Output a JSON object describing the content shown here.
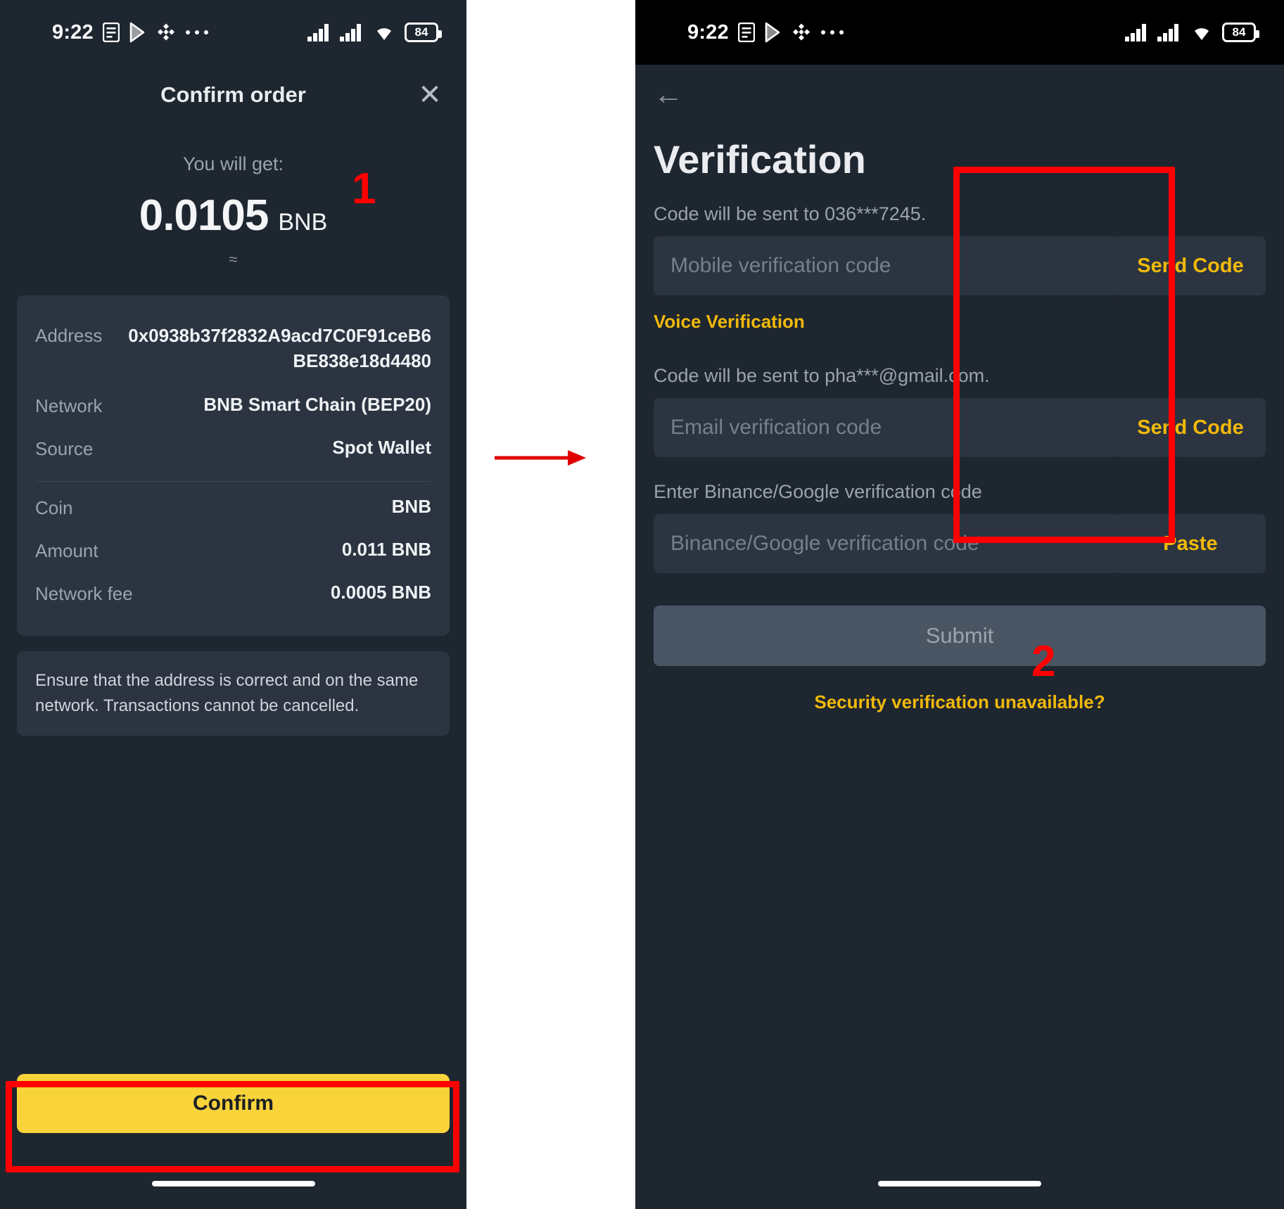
{
  "status_bar": {
    "time": "9:22",
    "battery_level": "84",
    "left_icons": [
      "note-icon",
      "play-store-icon",
      "binance-icon",
      "more-dots-icon"
    ],
    "right_icons": [
      "signal-bars-icon",
      "signal-bars-icon",
      "wifi-icon",
      "battery-icon"
    ]
  },
  "left_screen": {
    "title": "Confirm order",
    "close_label": "✕",
    "you_will_get_label": "You will get:",
    "amount_value": "0.0105",
    "amount_unit": "BNB",
    "approx_symbol": "≈",
    "details": [
      {
        "key": "Address",
        "value": "0x0938b37f2832A9acd7C0F91ceB6BE838e18d4480"
      },
      {
        "key": "Network",
        "value": "BNB Smart Chain (BEP20)"
      },
      {
        "key": "Source",
        "value": "Spot Wallet"
      }
    ],
    "summary": [
      {
        "key": "Coin",
        "value": "BNB"
      },
      {
        "key": "Amount",
        "value": "0.011 BNB"
      },
      {
        "key": "Network fee",
        "value": "0.0005 BNB"
      }
    ],
    "notice": "Ensure that the address is correct and on the same network. Transactions cannot be cancelled.",
    "confirm_button": "Confirm"
  },
  "right_screen": {
    "back_label": "←",
    "title": "Verification",
    "mobile_hint": "Code will be sent to 036***7245.",
    "mobile_placeholder": "Mobile verification code",
    "mobile_action": "Send Code",
    "voice_link": "Voice Verification",
    "email_hint": "Code will be sent to pha***@gmail.com.",
    "email_placeholder": "Email verification code",
    "email_action": "Send Code",
    "auth_hint": "Enter Binance/Google verification code",
    "auth_placeholder": "Binance/Google verification code",
    "auth_action": "Paste",
    "submit_button": "Submit",
    "unavailable_link": "Security verification unavailable?"
  },
  "annotations": {
    "step_one": "1",
    "step_two": "2",
    "highlight_color": "#ff0000"
  }
}
